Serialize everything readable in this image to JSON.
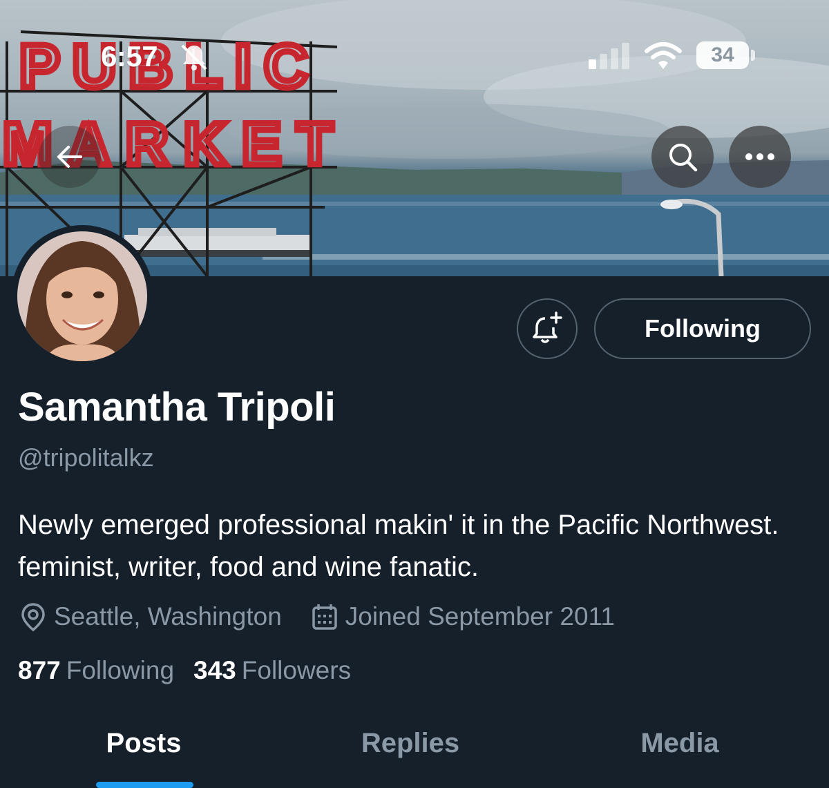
{
  "status_bar": {
    "time": "6:57",
    "battery": "34",
    "icons": [
      "bell-slash-icon",
      "cellular-signal-icon",
      "wifi-icon",
      "battery-icon"
    ]
  },
  "banner": {
    "sign_line1": "PUBLIC",
    "sign_line2": "MARKET"
  },
  "nav": {
    "back_icon": "arrow-left-icon",
    "search_icon": "search-icon",
    "more_icon": "more-horizontal-icon"
  },
  "actions": {
    "notify_icon": "bell-plus-icon",
    "following_label": "Following"
  },
  "profile": {
    "display_name": "Samantha Tripoli",
    "handle": "@tripolitalkz",
    "bio": "Newly emerged professional makin' it in the Pacific Northwest. feminist, writer, food and wine fanatic.",
    "location": "Seattle, Washington",
    "joined": "Joined September 2011",
    "following_count": "877",
    "following_label": "Following",
    "followers_count": "343",
    "followers_label": "Followers"
  },
  "tabs": [
    {
      "label": "Posts",
      "active": true
    },
    {
      "label": "Replies",
      "active": false
    },
    {
      "label": "Media",
      "active": false
    }
  ],
  "colors": {
    "background": "#15202b",
    "secondary_text": "#8b98a5",
    "accent": "#1d9bf0",
    "sign_red": "#c8262e"
  }
}
